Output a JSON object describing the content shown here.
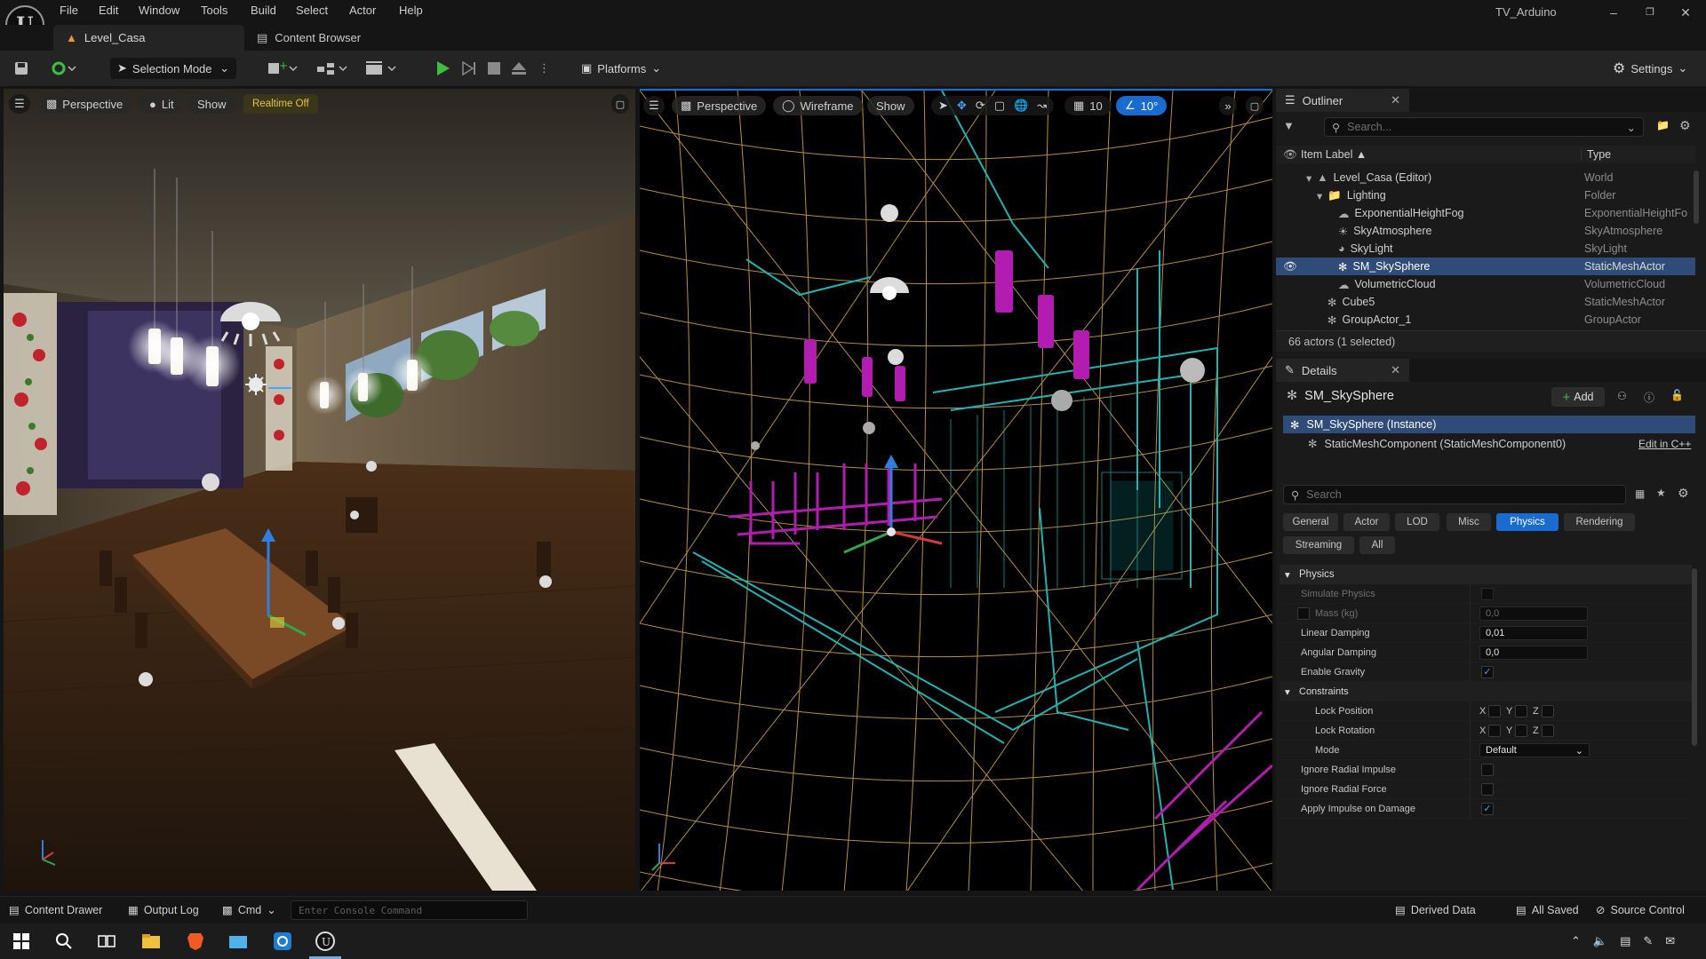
{
  "menu": [
    "File",
    "Edit",
    "Window",
    "Tools",
    "Build",
    "Select",
    "Actor",
    "Help"
  ],
  "project_name": "TV_Arduino",
  "tabs": {
    "level": "Level_Casa",
    "content_browser": "Content Browser"
  },
  "toolbar": {
    "selection_mode": "Selection Mode",
    "platforms": "Platforms",
    "settings": "Settings"
  },
  "viewport_left": {
    "perspective": "Perspective",
    "lit": "Lit",
    "show": "Show",
    "realtime": "Realtime Off"
  },
  "viewport_right": {
    "perspective": "Perspective",
    "wireframe": "Wireframe",
    "show": "Show",
    "grid_size": "10",
    "rotation_snap": "10°"
  },
  "outliner": {
    "title": "Outliner",
    "search_placeholder": "Search...",
    "col_label": "Item Label",
    "col_type": "Type",
    "rows": [
      {
        "label": "Level_Casa (Editor)",
        "type": "World",
        "icon": "level-icon"
      },
      {
        "label": "Lighting",
        "type": "Folder",
        "icon": "folder-icon"
      },
      {
        "label": "ExponentialHeightFog",
        "type": "ExponentialHeightFo",
        "icon": "fog-icon"
      },
      {
        "label": "SkyAtmosphere",
        "type": "SkyAtmosphere",
        "icon": "sun-icon"
      },
      {
        "label": "SkyLight",
        "type": "SkyLight",
        "icon": "skylight-icon"
      },
      {
        "label": "SM_SkySphere",
        "type": "StaticMeshActor",
        "icon": "mesh-icon"
      },
      {
        "label": "VolumetricCloud",
        "type": "VolumetricCloud",
        "icon": "cloud-icon"
      },
      {
        "label": "Cube5",
        "type": "StaticMeshActor",
        "icon": "mesh-icon"
      },
      {
        "label": "GroupActor_1",
        "type": "GroupActor",
        "icon": "group-icon"
      }
    ],
    "status": "66 actors (1 selected)"
  },
  "details": {
    "title": "Details",
    "actor_name": "SM_SkySphere",
    "add_label": "Add",
    "instance_label": "SM_SkySphere (Instance)",
    "component_label": "StaticMeshComponent (StaticMeshComponent0)",
    "edit_cpp": "Edit in C++",
    "search_placeholder": "Search",
    "filter_tabs": [
      "General",
      "Actor",
      "LOD",
      "Misc",
      "Physics",
      "Rendering",
      "Streaming",
      "All"
    ],
    "active_filter": "Physics",
    "section_physics": "Physics",
    "section_constraints": "Constraints",
    "props": {
      "simulate_physics": "Simulate Physics",
      "mass": "Mass (kg)",
      "mass_value": "0,0",
      "linear_damping": "Linear Damping",
      "linear_damping_value": "0,01",
      "angular_damping": "Angular Damping",
      "angular_damping_value": "0,0",
      "enable_gravity": "Enable Gravity",
      "lock_position": "Lock Position",
      "lock_rotation": "Lock Rotation",
      "mode": "Mode",
      "mode_value": "Default",
      "ignore_radial_impulse": "Ignore Radial Impulse",
      "ignore_radial_force": "Ignore Radial Force",
      "apply_impulse": "Apply Impulse on Damage",
      "axis_x": "X",
      "axis_y": "Y",
      "axis_z": "Z"
    }
  },
  "bottom": {
    "content_drawer": "Content Drawer",
    "output_log": "Output Log",
    "cmd": "Cmd",
    "console_placeholder": "Enter Console Command",
    "derived_data": "Derived Data",
    "all_saved": "All Saved",
    "source_control": "Source Control"
  },
  "colors": {
    "accent": "#1a6bd0",
    "play_green": "#3fbf3f",
    "wire_yellow": "#d8a84a",
    "wire_teal": "#1fb4b4",
    "wire_magenta": "#b21cb0"
  }
}
